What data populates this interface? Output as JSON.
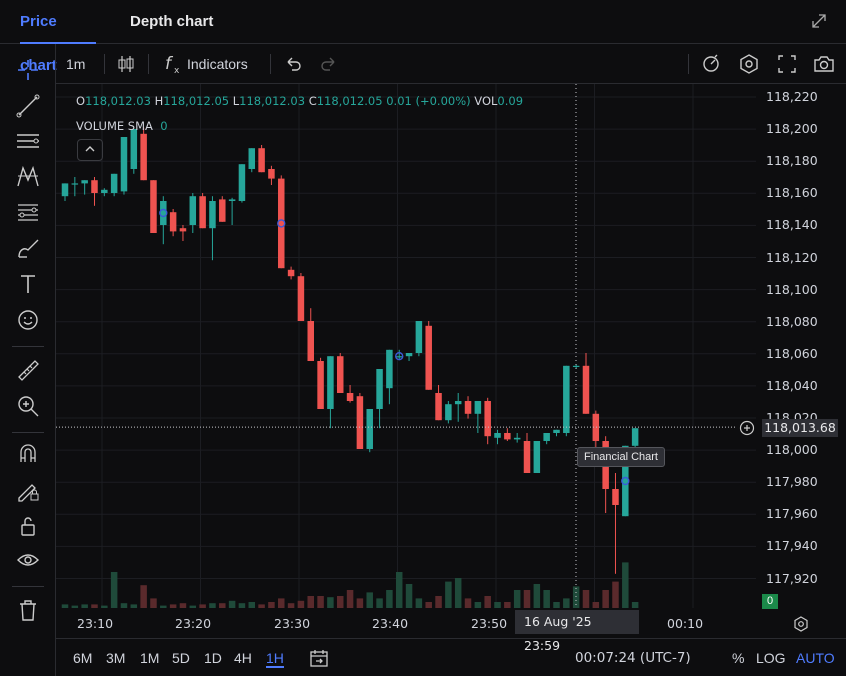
{
  "tabs": {
    "price_chart": "Price chart",
    "depth_chart": "Depth chart"
  },
  "toolbar": {
    "interval": "1m",
    "indicators_label": "Indicators"
  },
  "legend": {
    "o_label": "O",
    "o_value": "118,012.03",
    "h_label": "H",
    "h_value": "118,012.05",
    "l_label": "L",
    "l_value": "118,012.03",
    "c_label": "C",
    "c_value": "118,012.05",
    "change": "0.01 (+0.00%)",
    "vol_label": "VOL",
    "vol_value": "0.09",
    "sma_label": "VOLUME SMA",
    "sma_value": "0"
  },
  "price_axis": [
    "118,220",
    "118,200",
    "118,180",
    "118,160",
    "118,140",
    "118,120",
    "118,100",
    "118,080",
    "118,060",
    "118,040",
    "118,020",
    "118,000",
    "117,980",
    "117,960",
    "117,940",
    "117,920"
  ],
  "current_price": "118,013.68",
  "tooltip": "Financial Chart",
  "volume_badge": "0",
  "time_axis": [
    "23:10",
    "23:20",
    "23:30",
    "23:40",
    "23:50",
    "00:10"
  ],
  "crosshair_time": {
    "date": "16 Aug '25",
    "time": "23:59"
  },
  "ranges": [
    "6M",
    "3M",
    "1M",
    "5D",
    "1D",
    "4H",
    "1H"
  ],
  "active_range": "1H",
  "clock": "00:07:24 (UTC-7)",
  "scale_options": {
    "percent": "%",
    "log": "LOG",
    "auto": "AUTO"
  },
  "colors": {
    "up": "#26a69a",
    "down": "#ef5350",
    "accent": "#4f7cff"
  },
  "chart_data": {
    "type": "candlestick",
    "ylim": [
      117910,
      118225
    ],
    "candles": [
      {
        "o": 118158,
        "h": 118166,
        "l": 118155,
        "c": 118166
      },
      {
        "o": 118166,
        "h": 118170,
        "l": 118158,
        "c": 118166
      },
      {
        "o": 118166,
        "h": 118168,
        "l": 118159,
        "c": 118168
      },
      {
        "o": 118168,
        "h": 118170,
        "l": 118152,
        "c": 118160
      },
      {
        "o": 118160,
        "h": 118163,
        "l": 118158,
        "c": 118162
      },
      {
        "o": 118160,
        "h": 118172,
        "l": 118158,
        "c": 118172
      },
      {
        "o": 118161,
        "h": 118195,
        "l": 118159,
        "c": 118195
      },
      {
        "o": 118175,
        "h": 118200,
        "l": 118172,
        "c": 118200
      },
      {
        "o": 118197,
        "h": 118201,
        "l": 118168,
        "c": 118168
      },
      {
        "o": 118168,
        "h": 118168,
        "l": 118135,
        "c": 118135
      },
      {
        "o": 118140,
        "h": 118158,
        "l": 118128,
        "c": 118155
      },
      {
        "o": 118148,
        "h": 118150,
        "l": 118133,
        "c": 118136
      },
      {
        "o": 118138,
        "h": 118140,
        "l": 118130,
        "c": 118136
      },
      {
        "o": 118140,
        "h": 118160,
        "l": 118135,
        "c": 118158
      },
      {
        "o": 118158,
        "h": 118160,
        "l": 118138,
        "c": 118138
      },
      {
        "o": 118138,
        "h": 118158,
        "l": 118118,
        "c": 118155
      },
      {
        "o": 118156,
        "h": 118158,
        "l": 118142,
        "c": 118142
      },
      {
        "o": 118155,
        "h": 118157,
        "l": 118140,
        "c": 118156
      },
      {
        "o": 118155,
        "h": 118178,
        "l": 118154,
        "c": 118178
      },
      {
        "o": 118175,
        "h": 118188,
        "l": 118173,
        "c": 118188
      },
      {
        "o": 118188,
        "h": 118190,
        "l": 118173,
        "c": 118173
      },
      {
        "o": 118175,
        "h": 118177,
        "l": 118165,
        "c": 118169
      },
      {
        "o": 118169,
        "h": 118171,
        "l": 118113,
        "c": 118113
      },
      {
        "o": 118112,
        "h": 118114,
        "l": 118106,
        "c": 118108
      },
      {
        "o": 118108,
        "h": 118110,
        "l": 118080,
        "c": 118080
      },
      {
        "o": 118080,
        "h": 118088,
        "l": 118055,
        "c": 118055
      },
      {
        "o": 118055,
        "h": 118057,
        "l": 118025,
        "c": 118025
      },
      {
        "o": 118025,
        "h": 118058,
        "l": 118013,
        "c": 118058
      },
      {
        "o": 118058,
        "h": 118060,
        "l": 118035,
        "c": 118035
      },
      {
        "o": 118035,
        "h": 118040,
        "l": 118029,
        "c": 118030
      },
      {
        "o": 118033,
        "h": 118035,
        "l": 118000,
        "c": 118000
      },
      {
        "o": 118000,
        "h": 118025,
        "l": 117998,
        "c": 118025
      },
      {
        "o": 118025,
        "h": 118050,
        "l": 118013,
        "c": 118050
      },
      {
        "o": 118038,
        "h": 118062,
        "l": 118028,
        "c": 118062
      },
      {
        "o": 118058,
        "h": 118062,
        "l": 118056,
        "c": 118058
      },
      {
        "o": 118058,
        "h": 118060,
        "l": 118055,
        "c": 118060
      },
      {
        "o": 118060,
        "h": 118080,
        "l": 118058,
        "c": 118080
      },
      {
        "o": 118077,
        "h": 118080,
        "l": 118037,
        "c": 118037
      },
      {
        "o": 118035,
        "h": 118040,
        "l": 118018,
        "c": 118018
      },
      {
        "o": 118018,
        "h": 118030,
        "l": 118016,
        "c": 118028
      },
      {
        "o": 118028,
        "h": 118035,
        "l": 118017,
        "c": 118030
      },
      {
        "o": 118030,
        "h": 118033,
        "l": 118019,
        "c": 118022
      },
      {
        "o": 118022,
        "h": 118030,
        "l": 118010,
        "c": 118030
      },
      {
        "o": 118030,
        "h": 118032,
        "l": 118003,
        "c": 118008
      },
      {
        "o": 118007,
        "h": 118012,
        "l": 118003,
        "c": 118010
      },
      {
        "o": 118010,
        "h": 118013,
        "l": 118005,
        "c": 118006
      },
      {
        "o": 118006,
        "h": 118010,
        "l": 118004,
        "c": 118007
      },
      {
        "o": 118005,
        "h": 118010,
        "l": 117985,
        "c": 117985
      },
      {
        "o": 117985,
        "h": 118005,
        "l": 117985,
        "c": 118005
      },
      {
        "o": 118005,
        "h": 118010,
        "l": 118003,
        "c": 118010
      },
      {
        "o": 118010,
        "h": 118012,
        "l": 118008,
        "c": 118012
      },
      {
        "o": 118010,
        "h": 118052,
        "l": 118008,
        "c": 118052
      },
      {
        "o": 118052,
        "h": 118053,
        "l": 118050,
        "c": 118052
      },
      {
        "o": 118052,
        "h": 118060,
        "l": 118022,
        "c": 118022
      },
      {
        "o": 118022,
        "h": 118024,
        "l": 118000,
        "c": 118005
      },
      {
        "o": 118005,
        "h": 118008,
        "l": 117960,
        "c": 117975
      },
      {
        "o": 117975,
        "h": 117985,
        "l": 117922,
        "c": 117965
      },
      {
        "o": 117958,
        "h": 118002,
        "l": 117958,
        "c": 118002
      },
      {
        "o": 118002,
        "h": 118013,
        "l": 118000,
        "c": 118013
      }
    ],
    "volumes": [
      3,
      2,
      3,
      3,
      2,
      30,
      4,
      3,
      19,
      8,
      2,
      3,
      4,
      2,
      3,
      4,
      4,
      6,
      4,
      5,
      3,
      5,
      8,
      4,
      6,
      10,
      10,
      9,
      10,
      15,
      8,
      13,
      8,
      15,
      30,
      20,
      8,
      5,
      10,
      22,
      25,
      8,
      5,
      10,
      5,
      5,
      15,
      15,
      20,
      15,
      5,
      8,
      18,
      15,
      5,
      15,
      22,
      38,
      5
    ]
  }
}
